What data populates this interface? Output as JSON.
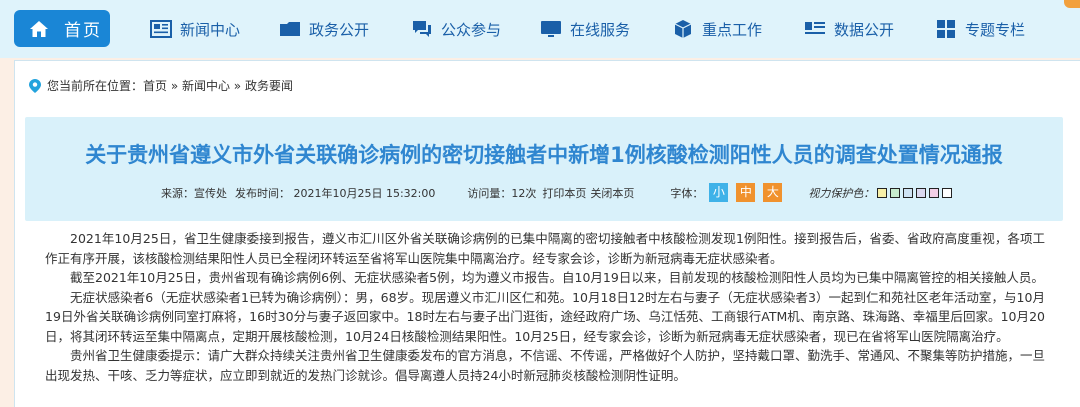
{
  "nav": {
    "home": "首页",
    "items": [
      "新闻中心",
      "政务公开",
      "公众参与",
      "在线服务",
      "重点工作",
      "数据公开",
      "专题专栏"
    ]
  },
  "breadcrumb": {
    "prefix": "您当前所在位置：",
    "trail": "首页 » 新闻中心 » 政务要闻"
  },
  "article": {
    "title": "关于贵州省遵义市外省关联确诊病例的密切接触者中新增1例核酸检测阳性人员的调查处置情况通报",
    "source": "来源：宣传处",
    "publish_time": "发布时间： 2021年10月25日 15:32:00",
    "visits": "访问量：12次",
    "print": "打印本页",
    "close": "关闭本页",
    "font_label": "字体：",
    "font_small": "小",
    "font_medium": "中",
    "font_large": "大",
    "eye_label": "视力保护色：",
    "eye_colors": [
      "#f7f0a8",
      "#c7eccd",
      "#cfe3f3",
      "#dad8ef",
      "#f3cfe6",
      "#ffffff"
    ],
    "paragraphs": [
      "2021年10月25日，省卫生健康委接到报告，遵义市汇川区外省关联确诊病例的已集中隔离的密切接触者中核酸检测发现1例阳性。接到报告后，省委、省政府高度重视，各项工作正有序开展，该核酸检测结果阳性人员已全程闭环转运至省将军山医院集中隔离治疗。经专家会诊，诊断为新冠病毒无症状感染者。",
      "截至2021年10月25日，贵州省现有确诊病例6例、无症状感染者5例，均为遵义市报告。自10月19日以来，目前发现的核酸检测阳性人员均为已集中隔离管控的相关接触人员。",
      "无症状感染者6（无症状感染者1已转为确诊病例）：男，68岁。现居遵义市汇川区仁和苑。10月18日12时左右与妻子（无症状感染者3）一起到仁和苑社区老年活动室，与10月19日外省关联确诊病例同室打麻将，16时30分与妻子返回家中。18时左右与妻子出门逛街，途经政府广场、乌江恬苑、工商银行ATM机、南京路、珠海路、幸福里后回家。10月20日，将其闭环转运至集中隔离点，定期开展核酸检测，10月24日核酸检测结果阳性。10月25日，经专家会诊，诊断为新冠病毒无症状感染者，现已在省将军山医院隔离治疗。",
      "贵州省卫生健康委提示：请广大群众持续关注贵州省卫生健康委发布的官方消息，不信谣、不传谣，严格做好个人防护，坚持戴口罩、勤洗手、常通风、不聚集等防护措施，一旦出现发热、干咳、乏力等症状，应立即到就近的发热门诊就诊。倡导离遵人员持24小时新冠肺炎核酸检测阴性证明。"
    ]
  },
  "colors": {
    "nav_bg": "#dff3fb",
    "home_bg": "#1a86d6",
    "nav_text": "#1a5fa8",
    "title": "#2f86d0",
    "title_bg": "#d9f1fa",
    "font_small_bg": "#3fb2e8",
    "font_medium_bg": "#f0922e",
    "font_large_bg": "#f0922e"
  }
}
